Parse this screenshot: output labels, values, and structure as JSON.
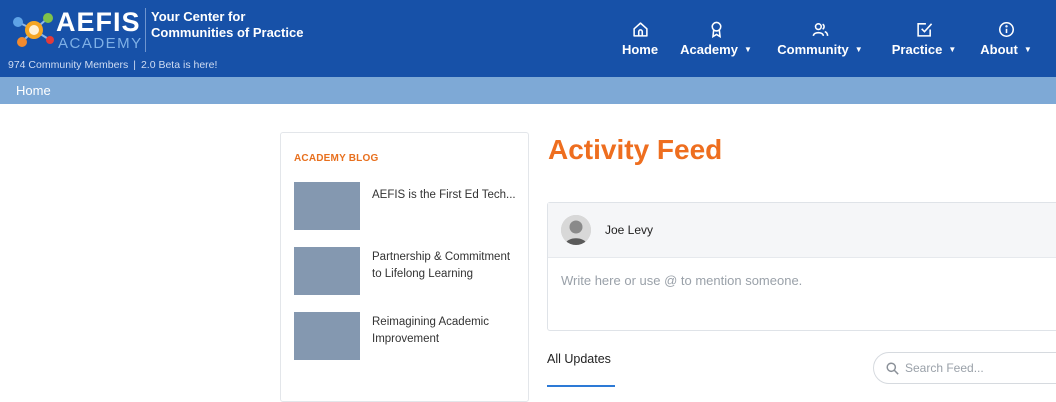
{
  "brand": {
    "name": "AEFIS",
    "sub": "ACADEMY",
    "tagline_1": "Your Center for",
    "tagline_2": "Communities of Practice",
    "members": "974 Community Members",
    "separator": "|",
    "beta": "2.0 Beta is here!"
  },
  "nav": {
    "items": [
      {
        "label": "Home",
        "icon": "home-icon",
        "has_caret": false
      },
      {
        "label": "Academy",
        "icon": "award-ribbon-icon",
        "has_caret": true
      },
      {
        "label": "Community",
        "icon": "users-icon",
        "has_caret": true
      },
      {
        "label": "Practice",
        "icon": "checkbox-icon",
        "has_caret": true
      },
      {
        "label": "About",
        "icon": "info-icon",
        "has_caret": true
      }
    ],
    "caret": "▼"
  },
  "breadcrumb": {
    "current": "Home"
  },
  "blog": {
    "title": "ACADEMY BLOG",
    "items": [
      {
        "title": "AEFIS is the First Ed Tech..."
      },
      {
        "title": "Partnership & Commitment to Lifelong Learning"
      },
      {
        "title": "Reimagining Academic Improvement"
      }
    ]
  },
  "feed": {
    "title": "Activity Feed",
    "user_name": "Joe Levy",
    "input_placeholder": "Write here or use @ to mention someone.",
    "tab_all": "All Updates",
    "search_placeholder": "Search Feed..."
  },
  "colors": {
    "header_bg": "#1751a8",
    "breadcrumb_bg": "#7ea9d6",
    "accent_orange": "#ee6e1f",
    "tab_underline": "#2d7ad6"
  }
}
